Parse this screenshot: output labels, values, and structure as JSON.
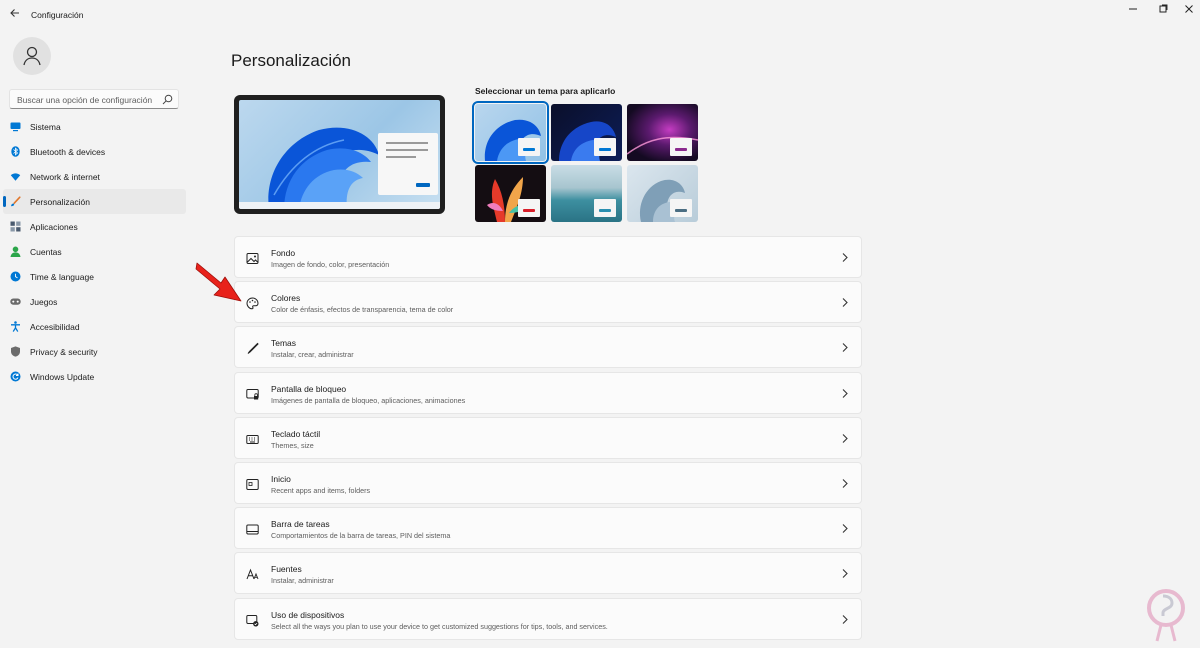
{
  "window": {
    "title": "Configuración",
    "back_icon": "back-arrow-icon"
  },
  "sidebar": {
    "search_placeholder": "Buscar una opción de configuración",
    "items": [
      {
        "label": "Sistema",
        "icon": "system-icon",
        "color": "#0078d4"
      },
      {
        "label": "Bluetooth & devices",
        "icon": "bluetooth-icon",
        "color": "#0078d4"
      },
      {
        "label": "Network & internet",
        "icon": "wifi-icon",
        "color": "#0078d4"
      },
      {
        "label": "Personalización",
        "icon": "brush-icon",
        "color": "#e0772c",
        "selected": true
      },
      {
        "label": "Aplicaciones",
        "icon": "apps-icon",
        "color": "#4a5a6e"
      },
      {
        "label": "Cuentas",
        "icon": "accounts-icon",
        "color": "#2ba64a"
      },
      {
        "label": "Time & language",
        "icon": "globe-clock-icon",
        "color": "#0078d4"
      },
      {
        "label": "Juegos",
        "icon": "gamepad-icon",
        "color": "#6b6b6b"
      },
      {
        "label": "Accesibilidad",
        "icon": "accessibility-icon",
        "color": "#0078d4"
      },
      {
        "label": "Privacy & security",
        "icon": "shield-icon",
        "color": "#6b6b6b"
      },
      {
        "label": "Windows Update",
        "icon": "update-icon",
        "color": "#0078d4"
      }
    ]
  },
  "main": {
    "page_title": "Personalización",
    "themes_label": "Seleccionar un tema para aplicarlo",
    "themes": [
      {
        "name": "theme-1",
        "button_color": "#0078d4",
        "selected": true
      },
      {
        "name": "theme-2",
        "button_color": "#0078d4"
      },
      {
        "name": "theme-3",
        "button_color": "#8b2a8e"
      },
      {
        "name": "theme-4",
        "button_color": "#d81e2a"
      },
      {
        "name": "theme-5",
        "button_color": "#2b8fb0"
      },
      {
        "name": "theme-6",
        "button_color": "#4a6d82"
      }
    ],
    "cards": [
      {
        "title": "Fondo",
        "subtitle": "Imagen de fondo, color, presentación",
        "icon": "image-icon"
      },
      {
        "title": "Colores",
        "subtitle": "Color de énfasis, efectos de transparencia, tema de color",
        "icon": "palette-icon"
      },
      {
        "title": "Temas",
        "subtitle": "Instalar, crear, administrar",
        "icon": "pen-icon"
      },
      {
        "title": "Pantalla de bloqueo",
        "subtitle": "Imágenes de pantalla de bloqueo, aplicaciones, animaciones",
        "icon": "lock-screen-icon"
      },
      {
        "title": "Teclado táctil",
        "subtitle": "Themes, size",
        "icon": "keyboard-icon"
      },
      {
        "title": "Inicio",
        "subtitle": "Recent apps and items, folders",
        "icon": "start-icon"
      },
      {
        "title": "Barra de tareas",
        "subtitle": "Comportamientos de la barra de tareas, PIN del sistema",
        "icon": "taskbar-icon"
      },
      {
        "title": "Fuentes",
        "subtitle": "Instalar, administrar",
        "icon": "fonts-icon"
      },
      {
        "title": "Uso de dispositivos",
        "subtitle": "Select all the ways you plan to use your device to get customized suggestions for tips, tools, and services.",
        "icon": "device-usage-icon"
      }
    ]
  },
  "colors": {
    "accent": "#0067c0",
    "annotation_arrow": "#e8221b"
  }
}
